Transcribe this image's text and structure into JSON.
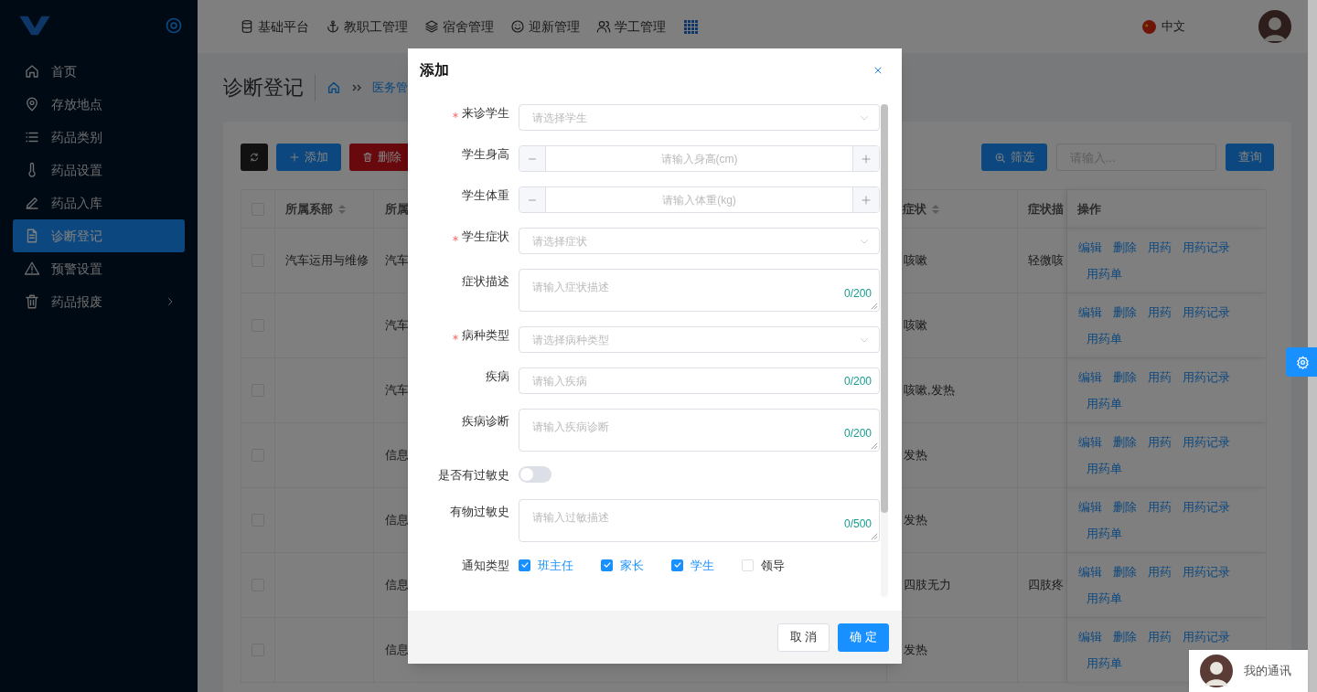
{
  "sidebar": {
    "items": [
      {
        "label": "首页",
        "kind": "home",
        "selected": false,
        "has_children": false
      },
      {
        "label": "存放地点",
        "kind": "pin",
        "selected": false,
        "has_children": false
      },
      {
        "label": "药品类别",
        "kind": "list",
        "selected": false,
        "has_children": false
      },
      {
        "label": "药品设置",
        "kind": "thermometer",
        "selected": false,
        "has_children": false
      },
      {
        "label": "药品入库",
        "kind": "pen",
        "selected": false,
        "has_children": false
      },
      {
        "label": "诊断登记",
        "kind": "document",
        "selected": true,
        "has_children": false
      },
      {
        "label": "预警设置",
        "kind": "warning",
        "selected": false,
        "has_children": false
      },
      {
        "label": "药品报废",
        "kind": "trash",
        "selected": false,
        "has_children": true
      }
    ]
  },
  "top_nav": {
    "items": [
      {
        "label": "基础平台",
        "kind": "database"
      },
      {
        "label": "教职工管理",
        "kind": "anchor"
      },
      {
        "label": "宿舍管理",
        "kind": "layers"
      },
      {
        "label": "迎新管理",
        "kind": "smile"
      },
      {
        "label": "学工管理",
        "kind": "users"
      }
    ]
  },
  "language": "中文",
  "page": {
    "title": "诊断登记",
    "breadcrumb": [
      "医务管"
    ]
  },
  "toolbar": {
    "buttons": [
      {
        "kind": "refresh"
      },
      {
        "kind": "add",
        "label": "添加"
      },
      {
        "kind": "delete",
        "label": "删除"
      }
    ],
    "filter_button": "筛选",
    "search": {
      "placeholder": "请输入..."
    },
    "query_button": "查询"
  },
  "table": {
    "select_all": {
      "checked": false
    },
    "columns": [
      {
        "label": "所属系部",
        "sortable": true
      },
      {
        "label": "所属",
        "sortable": false
      },
      {
        "label": "症状",
        "sortable": true
      },
      {
        "label": "症状描",
        "sortable": false
      },
      {
        "label": "操作",
        "sortable": false
      }
    ],
    "rows": [
      {
        "checked": false,
        "cells": [
          "汽车运用与维修",
          "汽车",
          "咳嗽",
          "轻微咳"
        ],
        "actions": [
          "编辑",
          "删除",
          "用药",
          "用药记录",
          "用药单"
        ]
      },
      {
        "checked": false,
        "cells": [
          "",
          "汽车",
          "咳嗽",
          ""
        ],
        "actions": [
          "编辑",
          "删除",
          "用药",
          "用药记录",
          "用药单"
        ]
      },
      {
        "checked": false,
        "cells": [
          "",
          "汽车",
          "咳嗽,发热",
          ""
        ],
        "actions": [
          "编辑",
          "删除",
          "用药",
          "用药记录",
          "用药单"
        ]
      },
      {
        "checked": false,
        "cells": [
          "",
          "信息",
          "发热",
          ""
        ],
        "actions": [
          "编辑",
          "删除",
          "用药",
          "用药记录",
          "用药单"
        ]
      },
      {
        "checked": false,
        "cells": [
          "",
          "信息",
          "发热",
          ""
        ],
        "actions": [
          "编辑",
          "删除",
          "用药",
          "用药记录",
          "用药单"
        ]
      },
      {
        "checked": false,
        "cells": [
          "",
          "信息",
          "四肢无力",
          "四肢疼"
        ],
        "actions": [
          "编辑",
          "删除",
          "用药",
          "用药记录",
          "用药单"
        ]
      },
      {
        "checked": false,
        "cells": [
          "",
          "信息",
          "发热",
          ""
        ],
        "actions": [
          "编辑",
          "删除",
          "用药",
          "用药记录",
          "用药单"
        ]
      }
    ]
  },
  "modal": {
    "title": "添加",
    "fields": [
      {
        "kind": "select",
        "label": "来诊学生",
        "required": true,
        "placeholder": "请选择学生"
      },
      {
        "kind": "number",
        "label": "学生身高",
        "required": false,
        "placeholder": "请输入身高(cm)"
      },
      {
        "kind": "number",
        "label": "学生体重",
        "required": false,
        "placeholder": "请输入体重(kg)"
      },
      {
        "kind": "select",
        "label": "学生症状",
        "required": true,
        "placeholder": "请选择症状"
      },
      {
        "kind": "textarea",
        "label": "症状描述",
        "required": false,
        "placeholder": "请输入症状描述",
        "counter": "0/200"
      },
      {
        "kind": "select",
        "label": "病种类型",
        "required": true,
        "placeholder": "请选择病种类型"
      },
      {
        "kind": "input",
        "label": "疾病",
        "required": false,
        "placeholder": "请输入疾病",
        "counter": "0/200"
      },
      {
        "kind": "textarea",
        "label": "疾病诊断",
        "required": false,
        "placeholder": "请输入疾病诊断",
        "counter": "0/200"
      },
      {
        "kind": "switch",
        "label": "是否有过敏史",
        "required": false,
        "on": false
      },
      {
        "kind": "textarea",
        "label": "有物过敏史",
        "required": false,
        "placeholder": "请输入过敏描述",
        "counter": "0/500"
      },
      {
        "kind": "checkboxes",
        "label": "通知类型",
        "required": false,
        "options": [
          {
            "label": "班主任",
            "checked": true
          },
          {
            "label": "家长",
            "checked": true
          },
          {
            "label": "学生",
            "checked": true
          },
          {
            "label": "领导",
            "checked": false
          }
        ]
      }
    ],
    "buttons": [
      {
        "kind": "default",
        "label": "取消"
      },
      {
        "kind": "primary",
        "label": "确定"
      }
    ]
  },
  "chat_widget": {
    "label": "我的通讯"
  }
}
